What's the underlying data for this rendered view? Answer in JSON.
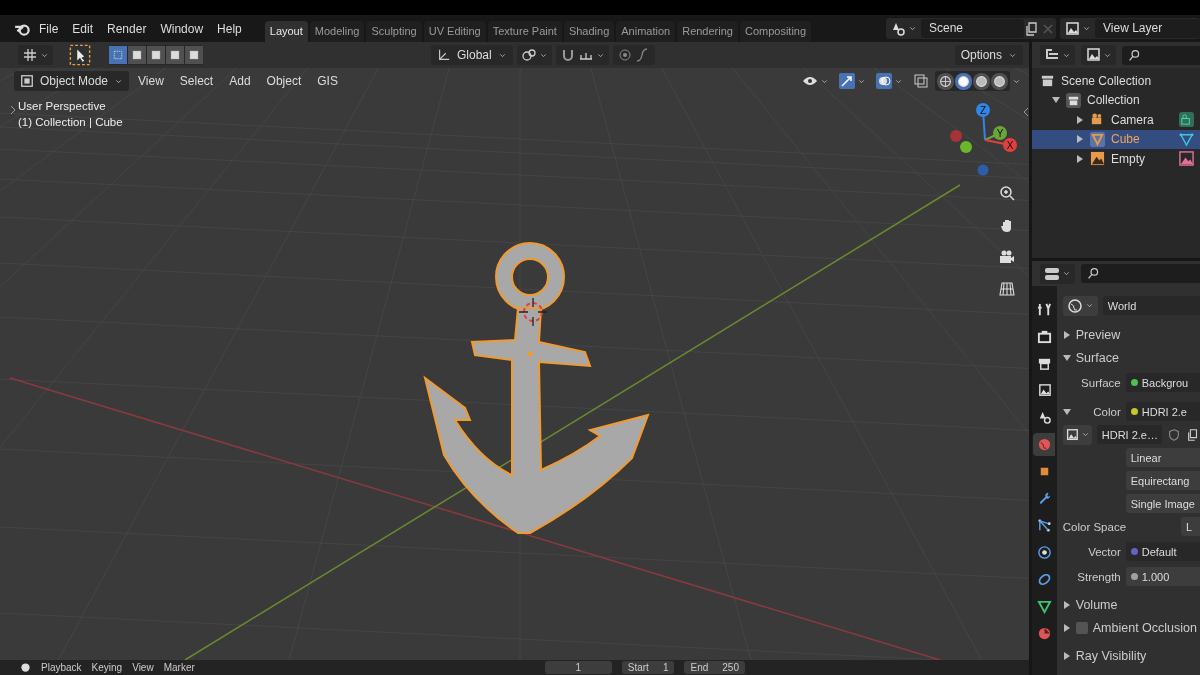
{
  "menu": [
    "File",
    "Edit",
    "Render",
    "Window",
    "Help"
  ],
  "workspace_tabs": [
    {
      "label": "Layout",
      "selected": true
    },
    {
      "label": "Modeling",
      "selected": false
    },
    {
      "label": "Sculpting",
      "selected": false
    },
    {
      "label": "UV Editing",
      "selected": false
    },
    {
      "label": "Texture Paint",
      "selected": false
    },
    {
      "label": "Shading",
      "selected": false
    },
    {
      "label": "Animation",
      "selected": false
    },
    {
      "label": "Rendering",
      "selected": false
    },
    {
      "label": "Compositing",
      "selected": false
    }
  ],
  "scene": {
    "name": "Scene"
  },
  "view_layer": {
    "name": "View Layer"
  },
  "tool_header": {
    "select_modes": [
      {
        "selected": true
      },
      {
        "selected": false
      },
      {
        "selected": false
      },
      {
        "selected": false
      },
      {
        "selected": false
      }
    ],
    "orientation": "Global",
    "options": "Options"
  },
  "viewport_header": {
    "mode": "Object Mode",
    "menus": [
      "View",
      "Select",
      "Add",
      "Object",
      "GIS"
    ],
    "shading": [
      {
        "selected": false
      },
      {
        "selected": true
      },
      {
        "selected": false
      },
      {
        "selected": false
      }
    ]
  },
  "overlay_text": [
    "User Perspective",
    "(1) Collection | Cube"
  ],
  "gizmo_axes": [
    "Z",
    "Y",
    "X"
  ],
  "outliner": {
    "root": "Scene Collection",
    "children": [
      {
        "label": "Collection",
        "expanded": true,
        "children": [
          {
            "label": "Camera",
            "kind": "camera",
            "selected": false,
            "expanded": false
          },
          {
            "label": "Cube",
            "kind": "mesh",
            "selected": true,
            "expanded": false
          },
          {
            "label": "Empty",
            "kind": "image",
            "selected": false,
            "expanded": false
          }
        ]
      }
    ]
  },
  "properties": {
    "tabs": [
      {
        "kind": "tool",
        "selected": false
      },
      {
        "kind": "render",
        "selected": false
      },
      {
        "kind": "output",
        "selected": false
      },
      {
        "kind": "view_layer",
        "selected": false
      },
      {
        "kind": "scene",
        "selected": false
      },
      {
        "kind": "world",
        "selected": true
      },
      {
        "kind": "object",
        "selected": false
      },
      {
        "kind": "modifiers",
        "selected": false
      },
      {
        "kind": "particles",
        "selected": false
      },
      {
        "kind": "physics",
        "selected": false
      },
      {
        "kind": "constraints",
        "selected": false
      },
      {
        "kind": "data",
        "selected": false
      },
      {
        "kind": "material",
        "selected": false
      }
    ],
    "world": "World",
    "rows": [
      {
        "kind": "panel",
        "label": "Preview",
        "expanded": false
      },
      {
        "kind": "panel",
        "label": "Surface",
        "expanded": true
      },
      {
        "kind": "socket",
        "label": "Surface",
        "value": "Backgrou",
        "color": "#4fbf4f"
      },
      {
        "kind": "socket",
        "label": "Color",
        "value": "HDRI 2.e",
        "color": "#c7c729",
        "expanded": true
      },
      {
        "kind": "image",
        "value": "HDRI 2.e…"
      },
      {
        "kind": "dropdown",
        "value": "Linear"
      },
      {
        "kind": "dropdown",
        "value": "Equirectang"
      },
      {
        "kind": "dropdown",
        "value": "Single Image"
      },
      {
        "kind": "field",
        "label": "Color Space",
        "value": "L"
      },
      {
        "kind": "socket",
        "label": "Vector",
        "value": "Default",
        "color": "#6363c7"
      },
      {
        "kind": "number",
        "label": "Strength",
        "value": "1.000",
        "color": "#a1a1a1"
      },
      {
        "kind": "panel",
        "label": "Volume",
        "expanded": false
      },
      {
        "kind": "checkpanel",
        "label": "Ambient Occlusion",
        "expanded": false,
        "checked": false
      },
      {
        "kind": "panel",
        "label": "Ray Visibility",
        "expanded": false
      }
    ]
  },
  "timeline": {
    "menus": [
      "Playback",
      "Keying",
      "View",
      "Marker"
    ],
    "current_frame": "1",
    "start_label": "Start",
    "start": "1",
    "end_label": "End",
    "end": "250"
  }
}
